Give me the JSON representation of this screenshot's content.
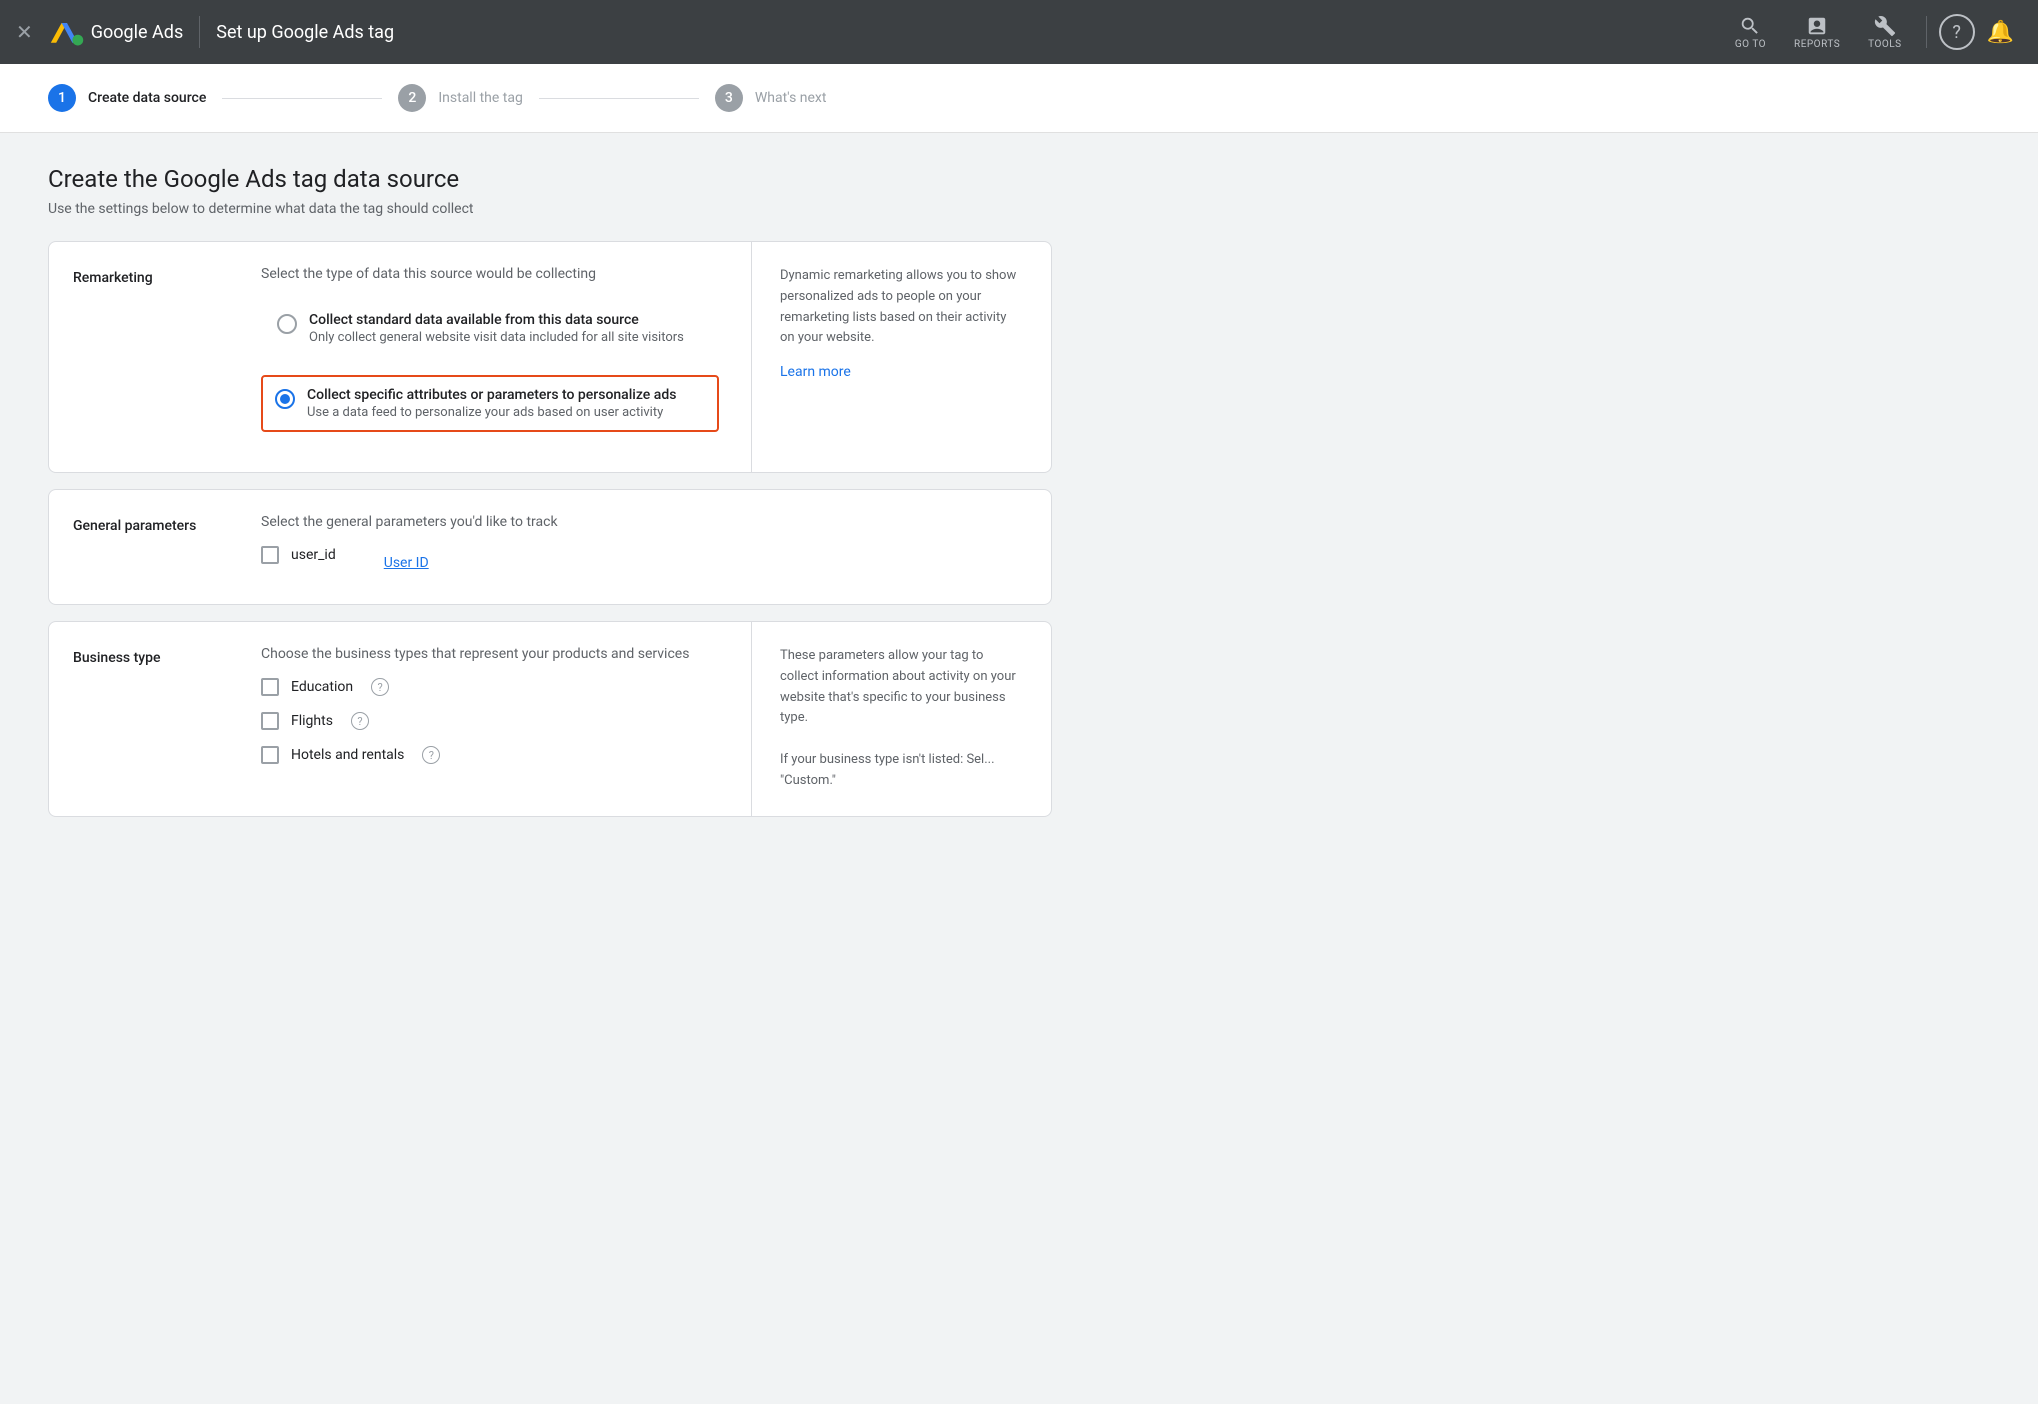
{
  "topNav": {
    "close_label": "×",
    "logo_text": "Google Ads",
    "page_title": "Set up Google Ads tag",
    "goto_label": "GO TO",
    "reports_label": "REPORTS",
    "tools_label": "TOOLS"
  },
  "stepper": {
    "steps": [
      {
        "number": "1",
        "label": "Create data source",
        "active": true
      },
      {
        "number": "2",
        "label": "Install the tag",
        "active": false
      },
      {
        "number": "3",
        "label": "What's next",
        "active": false
      }
    ]
  },
  "main": {
    "title": "Create the Google Ads tag data source",
    "subtitle": "Use the settings below to determine what data the tag should collect"
  },
  "remarketing": {
    "section_label": "Remarketing",
    "section_title": "Select the type of data this source would be collecting",
    "option1_label": "Collect standard data available from this data source",
    "option1_desc": "Only collect general website visit data included for all site visitors",
    "option2_label": "Collect specific attributes or parameters to personalize ads",
    "option2_desc": "Use a data feed to personalize your ads based on user activity",
    "right_text_1": "Dynamic remarketing allows you to show personalized ads to people on your remarketing lists based on their activity on your website.",
    "learn_more": "Learn more"
  },
  "generalParams": {
    "section_label": "General parameters",
    "section_title": "Select the general parameters you'd like to track",
    "param1_id": "user_id",
    "param1_link": "User ID"
  },
  "businessType": {
    "section_label": "Business type",
    "section_title": "Choose the business types that represent your products and services",
    "options": [
      {
        "label": "Education",
        "has_help": true
      },
      {
        "label": "Flights",
        "has_help": true
      },
      {
        "label": "Hotels and rentals",
        "has_help": true
      }
    ],
    "right_text": "These parameters allow your tag to collect information about activity on your website that's specific to your business type.",
    "right_text2": "If your business type isn't listed: Sel... \"Custom.\""
  }
}
